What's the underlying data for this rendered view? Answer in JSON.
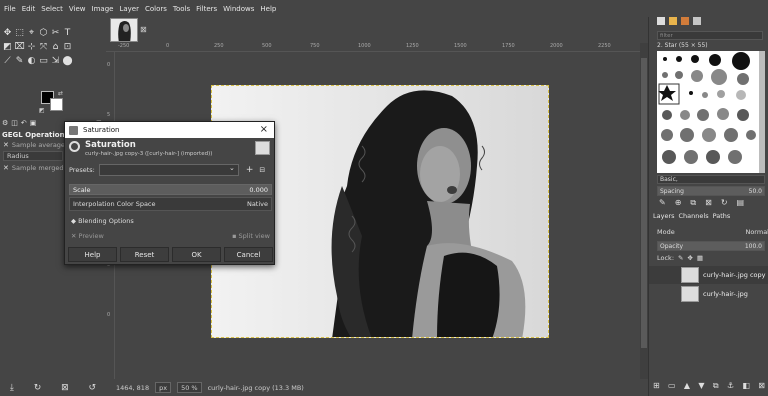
{
  "menu": [
    "File",
    "Edit",
    "Select",
    "View",
    "Image",
    "Layer",
    "Colors",
    "Tools",
    "Filters",
    "Windows",
    "Help"
  ],
  "image_tab": {
    "close": "⊠"
  },
  "toolbox": {
    "tool_icons": [
      "✥",
      "⬚",
      "⌖",
      "⬡",
      "✂",
      "T",
      "◩",
      "⌧",
      "⊹",
      "⤧",
      "⌂",
      "⊡",
      "⟋",
      "✎",
      "◐",
      "▭",
      "⇲",
      "⬤"
    ],
    "options_title": "GEGL Operation",
    "sample_average": "Sample average",
    "radius": "Radius",
    "sample_merged": "Sample merged"
  },
  "ruler_ticks": [
    "-250",
    "0",
    "250",
    "500",
    "750",
    "1000",
    "1250",
    "1500",
    "1750",
    "2000",
    "2250"
  ],
  "vruler_ticks": [
    "0",
    "5",
    "0",
    "7",
    "5",
    "0"
  ],
  "status": {
    "coords": "1464, 818",
    "unit": "px",
    "zoom": "50 %",
    "info": "curly-hair-.jpg copy (13.3 MB)"
  },
  "right_dock": {
    "filter_placeholder": "filter",
    "brush_name": "2. Star (55 × 55)",
    "preset_select": "Basic,",
    "spacing_label": "Spacing",
    "spacing_value": "50.0",
    "tab_layers": "Layers",
    "tab_channels": "Channels",
    "tab_paths": "Paths",
    "mode_label": "Mode",
    "mode_value": "Normal",
    "opacity_label": "Opacity",
    "opacity_value": "100.0",
    "lock_label": "Lock:",
    "layers": [
      {
        "name": "curly-hair-.jpg copy",
        "selected": true
      },
      {
        "name": "curly-hair-.jpg",
        "selected": false
      }
    ]
  },
  "dialog": {
    "window_title": "Saturation",
    "heading": "Saturation",
    "subheading": "curly-hair-.jpg copy-3 ([curly-hair-] (imported))",
    "presets_label": "Presets:",
    "scale_label": "Scale",
    "scale_value": "0.000",
    "interp_label": "Interpolation Color Space",
    "interp_value": "Native",
    "blending": "Blending Options",
    "preview": "Preview",
    "split_view": "Split view",
    "buttons": {
      "help": "Help",
      "reset": "Reset",
      "ok": "OK",
      "cancel": "Cancel"
    }
  }
}
